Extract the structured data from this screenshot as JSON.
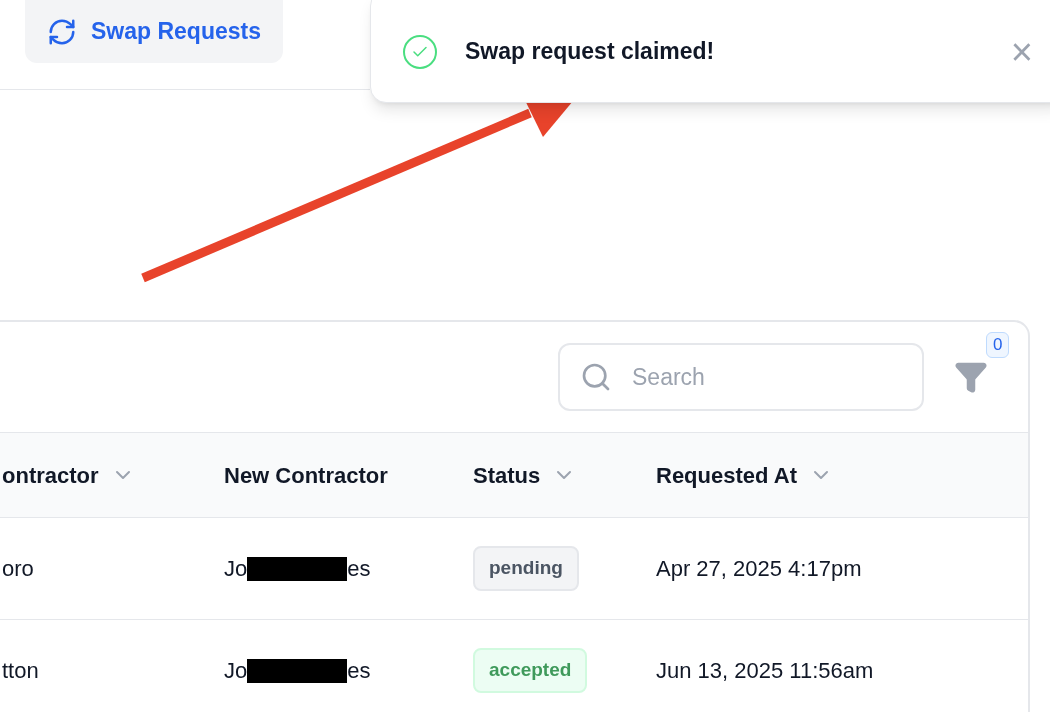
{
  "header": {
    "button": "Swap Requests"
  },
  "toast": {
    "message": "Swap request claimed!",
    "kind": "success",
    "close": "×"
  },
  "table": {
    "search": {
      "placeholder": "Search"
    },
    "filter_count": "0",
    "columns": [
      {
        "label": "ontractor",
        "sortable": true
      },
      {
        "label": "New Contractor",
        "sortable": false
      },
      {
        "label": "Status",
        "sortable": true
      },
      {
        "label": "Requested At",
        "sortable": true
      }
    ],
    "rows": [
      {
        "column_1": "oro",
        "new_contractor": {
          "prefix": "Jo",
          "suffix": "es",
          "redacted": true
        },
        "status": {
          "label": "pending",
          "kind": "pending"
        },
        "requested_at": "Apr 27, 2025 4:17pm"
      },
      {
        "column_1": "tton",
        "new_contractor": {
          "prefix": "Jo",
          "suffix": "es",
          "redacted": true
        },
        "status": {
          "label": "accepted",
          "kind": "accepted"
        },
        "requested_at": "Jun 13, 2025 11:56am"
      }
    ]
  }
}
